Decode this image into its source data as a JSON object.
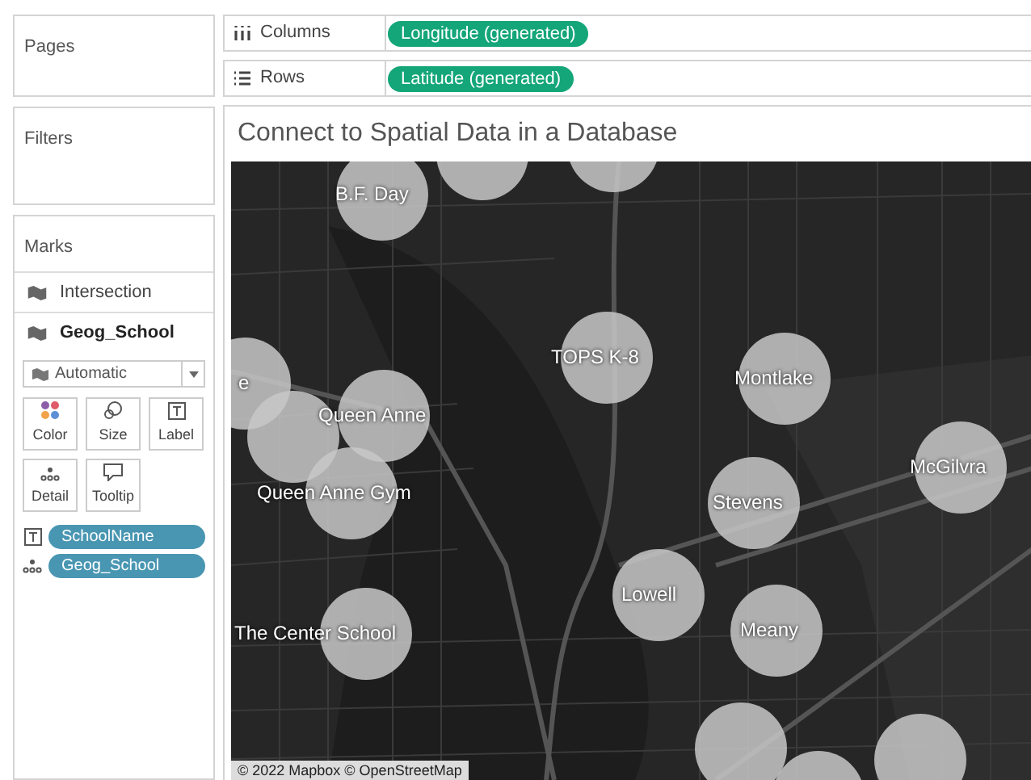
{
  "pages": {
    "title": "Pages"
  },
  "filters": {
    "title": "Filters"
  },
  "marks": {
    "title": "Marks",
    "layers": [
      {
        "label": "Intersection",
        "selected": false
      },
      {
        "label": "Geog_School",
        "selected": true
      }
    ],
    "mark_type": "Automatic",
    "cards": [
      {
        "kind": "color",
        "label": "Color"
      },
      {
        "kind": "size",
        "label": "Size"
      },
      {
        "kind": "label",
        "label": "Label"
      },
      {
        "kind": "detail",
        "label": "Detail"
      },
      {
        "kind": "tooltip",
        "label": "Tooltip"
      }
    ],
    "fields": [
      {
        "kind": "label",
        "name": "SchoolName"
      },
      {
        "kind": "detail",
        "name": "Geog_School"
      }
    ]
  },
  "shelves": [
    {
      "kind": "columns",
      "label": "Columns",
      "pill": "Longitude (generated)"
    },
    {
      "kind": "rows",
      "label": "Rows",
      "pill": "Latitude (generated)"
    }
  ],
  "view": {
    "title": "Connect to Spatial Data in a Database",
    "map_labels": [
      "B.F. Day",
      "TOPS K-8",
      "Montlake",
      "McGilvra",
      "e",
      "Queen Anne",
      "Queen Anne Gym",
      "Stevens",
      "Lowell",
      "Meany",
      "The Center School"
    ],
    "attribution": "© 2022 Mapbox © OpenStreetMap"
  }
}
